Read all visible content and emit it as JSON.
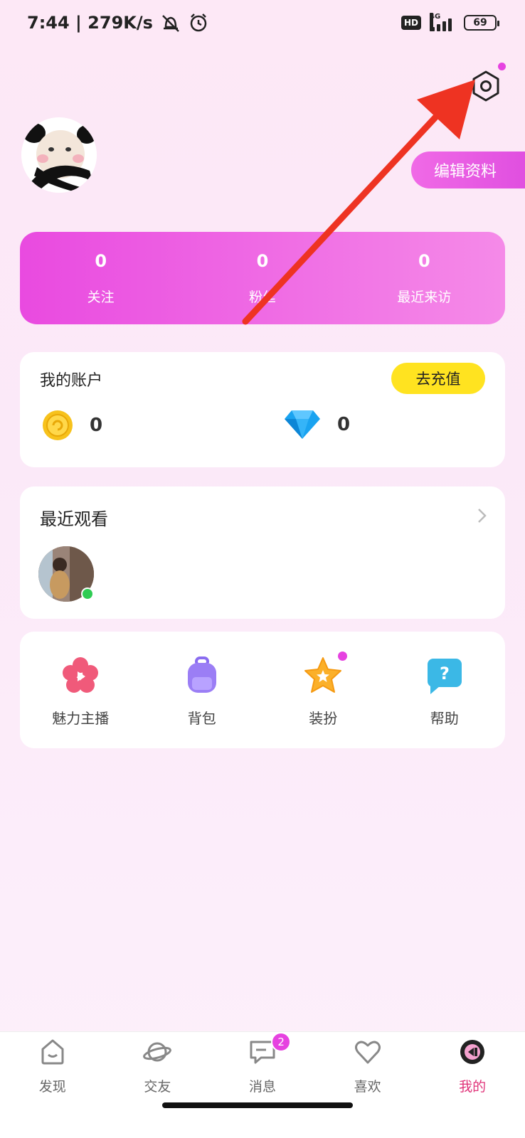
{
  "status_bar": {
    "time": "7:44 | 279K/s",
    "hd": "HD",
    "network": "4G",
    "battery": "69"
  },
  "profile": {
    "edit_label": "编辑资料"
  },
  "stats": [
    {
      "value": "0",
      "label": "关注"
    },
    {
      "value": "0",
      "label": "粉丝"
    },
    {
      "value": "0",
      "label": "最近来访"
    }
  ],
  "account": {
    "title": "我的账户",
    "recharge_label": "去充值",
    "coins": "0",
    "diamonds": "0"
  },
  "recent": {
    "title": "最近观看"
  },
  "menu": [
    {
      "label": "魅力主播",
      "icon": "flower-icon"
    },
    {
      "label": "背包",
      "icon": "backpack-icon"
    },
    {
      "label": "装扮",
      "icon": "star-icon"
    },
    {
      "label": "帮助",
      "icon": "help-icon"
    }
  ],
  "nav": [
    {
      "label": "发现",
      "icon": "home-icon"
    },
    {
      "label": "交友",
      "icon": "planet-icon"
    },
    {
      "label": "消息",
      "icon": "message-icon",
      "badge": "2"
    },
    {
      "label": "喜欢",
      "icon": "heart-icon"
    },
    {
      "label": "我的",
      "icon": "profile-icon",
      "active": true
    }
  ],
  "colors": {
    "accent": "#e94ae0",
    "recharge": "#ffe320",
    "online": "#2ecc53"
  }
}
